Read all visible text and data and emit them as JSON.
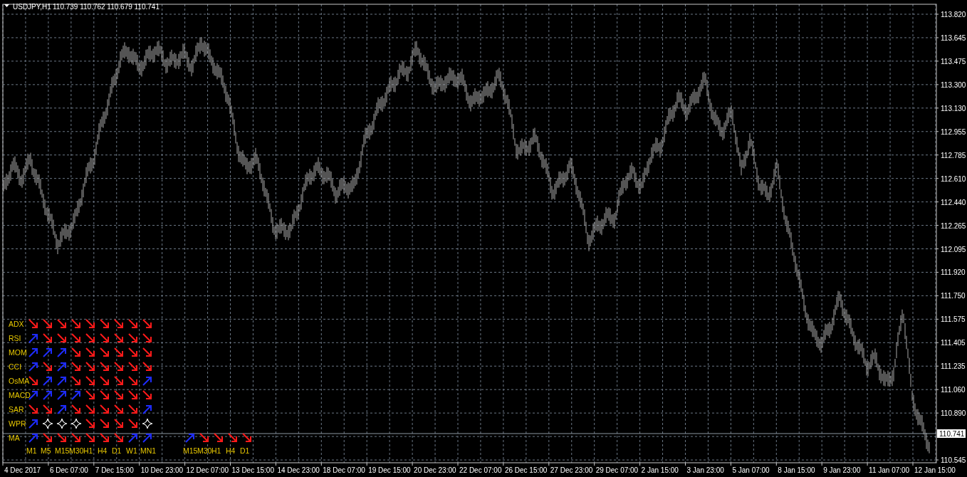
{
  "header": {
    "symbol": "USDJPY,H1",
    "quote": "110.739 110.762 110.679 110.741"
  },
  "chart": {
    "current_price": "110.741",
    "price_axis": [
      "113.820",
      "113.645",
      "113.475",
      "113.300",
      "113.130",
      "112.955",
      "112.785",
      "112.610",
      "112.440",
      "112.265",
      "112.095",
      "111.920",
      "111.750",
      "111.575",
      "111.405",
      "111.235",
      "111.060",
      "110.890",
      "110.545"
    ],
    "time_axis": [
      "4 Dec 2017",
      "6 Dec 07:00",
      "7 Dec 15:00",
      "10 Dec 23:00",
      "12 Dec 07:00",
      "13 Dec 15:00",
      "14 Dec 23:00",
      "18 Dec 07:00",
      "19 Dec 15:00",
      "20 Dec 23:00",
      "22 Dec 07:00",
      "26 Dec 15:00",
      "27 Dec 23:00",
      "29 Dec 07:00",
      "2 Jan 15:00",
      "3 Jan 23:00",
      "5 Jan 07:00",
      "8 Jan 15:00",
      "9 Jan 23:00",
      "11 Jan 07:00",
      "12 Jan 15:00"
    ]
  },
  "indicators": {
    "rows": [
      {
        "label": "ADX",
        "signals": [
          {
            "kind": "down"
          },
          {
            "kind": "down"
          },
          {
            "kind": "down"
          },
          {
            "kind": "down"
          },
          {
            "kind": "down"
          },
          {
            "kind": "down"
          },
          {
            "kind": "down"
          },
          {
            "kind": "down"
          },
          {
            "kind": "down"
          }
        ]
      },
      {
        "label": "RSI",
        "signals": [
          {
            "kind": "up"
          },
          {
            "kind": "down"
          },
          {
            "kind": "down"
          },
          {
            "kind": "down"
          },
          {
            "kind": "down"
          },
          {
            "kind": "down"
          },
          {
            "kind": "down"
          },
          {
            "kind": "down"
          },
          {
            "kind": "down"
          }
        ]
      },
      {
        "label": "MOM",
        "signals": [
          {
            "kind": "up"
          },
          {
            "kind": "up"
          },
          {
            "kind": "up"
          },
          {
            "kind": "down"
          },
          {
            "kind": "down"
          },
          {
            "kind": "down"
          },
          {
            "kind": "down"
          },
          {
            "kind": "down"
          },
          {
            "kind": "down"
          }
        ]
      },
      {
        "label": "CCI",
        "signals": [
          {
            "kind": "up"
          },
          {
            "kind": "down"
          },
          {
            "kind": "up"
          },
          {
            "kind": "down"
          },
          {
            "kind": "down"
          },
          {
            "kind": "down"
          },
          {
            "kind": "down"
          },
          {
            "kind": "down"
          },
          {
            "kind": "down"
          }
        ]
      },
      {
        "label": "OsMA",
        "signals": [
          {
            "kind": "down"
          },
          {
            "kind": "up"
          },
          {
            "kind": "up"
          },
          {
            "kind": "down"
          },
          {
            "kind": "down"
          },
          {
            "kind": "down"
          },
          {
            "kind": "down"
          },
          {
            "kind": "down"
          },
          {
            "kind": "up"
          }
        ]
      },
      {
        "label": "MACD",
        "signals": [
          {
            "kind": "up"
          },
          {
            "kind": "up"
          },
          {
            "kind": "up"
          },
          {
            "kind": "up"
          },
          {
            "kind": "down"
          },
          {
            "kind": "down"
          },
          {
            "kind": "down"
          },
          {
            "kind": "down"
          },
          {
            "kind": "down"
          }
        ]
      },
      {
        "label": "SAR",
        "signals": [
          {
            "kind": "down"
          },
          {
            "kind": "down"
          },
          {
            "kind": "up"
          },
          {
            "kind": "down"
          },
          {
            "kind": "down"
          },
          {
            "kind": "down"
          },
          {
            "kind": "down"
          },
          {
            "kind": "down"
          },
          {
            "kind": "up"
          }
        ]
      },
      {
        "label": "WPR",
        "signals": [
          {
            "kind": "up"
          },
          {
            "kind": "star"
          },
          {
            "kind": "star"
          },
          {
            "kind": "star"
          },
          {
            "kind": "down"
          },
          {
            "kind": "down"
          },
          {
            "kind": "down"
          },
          {
            "kind": "down"
          },
          {
            "kind": "star"
          }
        ]
      },
      {
        "label": "MA",
        "signals": [
          {
            "kind": "up"
          },
          {
            "kind": "down"
          },
          {
            "kind": "down"
          },
          {
            "kind": "down"
          },
          {
            "kind": "down"
          },
          {
            "kind": "down"
          },
          {
            "kind": "down"
          },
          {
            "kind": "up"
          },
          {
            "kind": "up"
          }
        ]
      }
    ],
    "timeframes": [
      "M1",
      "M5",
      "M15",
      "M30",
      "H1",
      "H4",
      "D1",
      "W1",
      "MN1"
    ],
    "extra": {
      "signals": [
        {
          "kind": "up"
        },
        {
          "kind": "down"
        },
        {
          "kind": "down"
        },
        {
          "kind": "down"
        },
        {
          "kind": "down"
        }
      ],
      "timeframes": [
        "M15",
        "M30",
        "H1",
        "H4",
        "D1"
      ]
    }
  }
}
